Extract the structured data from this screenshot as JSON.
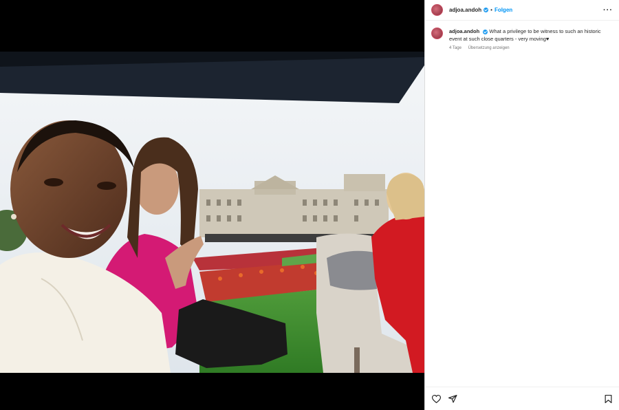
{
  "post": {
    "username": "adjoa.andoh",
    "separator": "•",
    "follow_label": "Folgen",
    "more_label": "···",
    "caption": "What a privilege to be witness to such an historic event at such close quarters - very moving♥",
    "time_ago": "4 Tage",
    "translate_label": "Übersetzung anzeigen"
  },
  "icons": {
    "verified": "verified-badge-icon",
    "like": "heart-icon",
    "share": "paper-plane-icon",
    "save": "bookmark-icon"
  },
  "colors": {
    "link": "#0095f6",
    "verified": "#1d9bf0",
    "text": "#262626",
    "secondary": "#737373"
  }
}
